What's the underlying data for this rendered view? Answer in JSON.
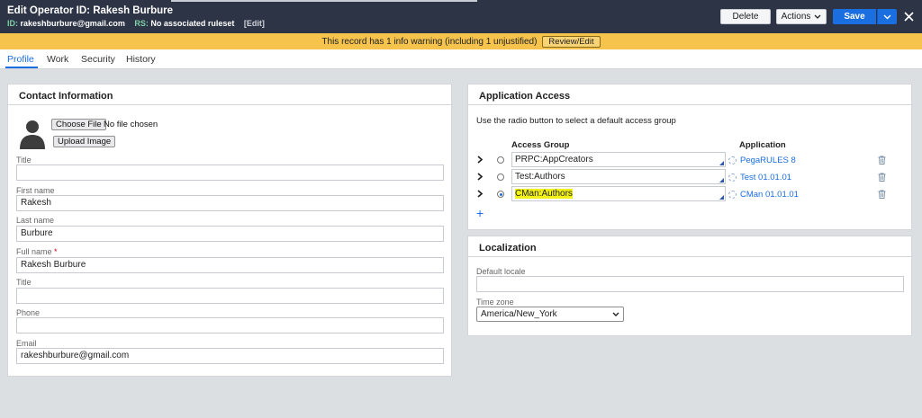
{
  "header": {
    "title": "Edit  Operator ID: Rakesh Burbure",
    "id_label": "ID:",
    "id_value": "rakeshburbure@gmail.com",
    "rs_label": "RS:",
    "rs_value": "No associated ruleset",
    "edit_label": "[Edit]",
    "delete_label": "Delete",
    "actions_label": "Actions",
    "save_label": "Save",
    "close_icon": "close-icon"
  },
  "warning": {
    "text": "This record has 1 info warning (including 1 unjustified)",
    "button": "Review/Edit"
  },
  "tabs": [
    {
      "label": "Profile",
      "active": true
    },
    {
      "label": "Work"
    },
    {
      "label": "Security"
    },
    {
      "label": "History"
    }
  ],
  "contact": {
    "heading": "Contact Information",
    "choose_file": "Choose File",
    "no_file": "No file chosen",
    "upload": "Upload Image",
    "fields": [
      {
        "label": "Title",
        "value": ""
      },
      {
        "label": "First name",
        "value": "Rakesh"
      },
      {
        "label": "Last name",
        "value": "Burbure"
      },
      {
        "label": "Full name",
        "value": "Rakesh Burbure",
        "required": true
      },
      {
        "label": "Title",
        "value": ""
      },
      {
        "label": "Phone",
        "value": ""
      },
      {
        "label": "Email",
        "value": "rakeshburbure@gmail.com"
      }
    ],
    "required_mark": "*"
  },
  "app_access": {
    "heading": "Application Access",
    "description": "Use the radio button to select a default access group",
    "col_access_group": "Access Group",
    "col_application": "Application",
    "rows": [
      {
        "group": "PRPC:AppCreators",
        "app": "PegaRULES  8",
        "selected": false
      },
      {
        "group": "Test:Authors",
        "app": "Test  01.01.01",
        "selected": false
      },
      {
        "group": "CMan:Authors",
        "app": "CMan  01.01.01",
        "selected": true
      }
    ],
    "add_label": "+"
  },
  "localization": {
    "heading": "Localization",
    "locale_label": "Default locale",
    "locale_value": "",
    "timezone_label": "Time zone",
    "timezone_value": "America/New_York"
  },
  "colors": {
    "header_bg": "#2d3446",
    "accent": "#1b6ee0",
    "warning_bg": "#f6c44d",
    "highlight": "#f2f21a"
  }
}
